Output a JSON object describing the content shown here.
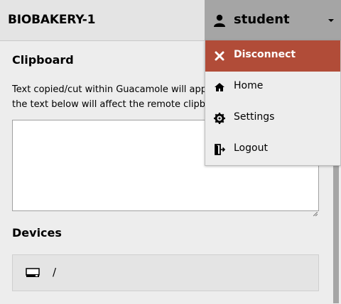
{
  "header": {
    "connection_name": "BIOBAKERY-1",
    "user_name": "student"
  },
  "user_menu": {
    "items": [
      {
        "label": "Disconnect",
        "icon": "close-icon"
      },
      {
        "label": "Home",
        "icon": "home-icon"
      },
      {
        "label": "Settings",
        "icon": "gear-icon"
      },
      {
        "label": "Logout",
        "icon": "logout-icon"
      }
    ]
  },
  "clipboard": {
    "title": "Clipboard",
    "description_line1": "Text copied/cut within Guacamole will app",
    "description_line2": "the text below will affect the remote clipb",
    "value": ""
  },
  "devices": {
    "title": "Devices",
    "items": [
      {
        "name": "/",
        "icon": "drive-icon"
      }
    ]
  },
  "colors": {
    "danger": "#b14c38",
    "user_menu_bg": "#a5a5a5",
    "panel_bg": "#ededed"
  }
}
